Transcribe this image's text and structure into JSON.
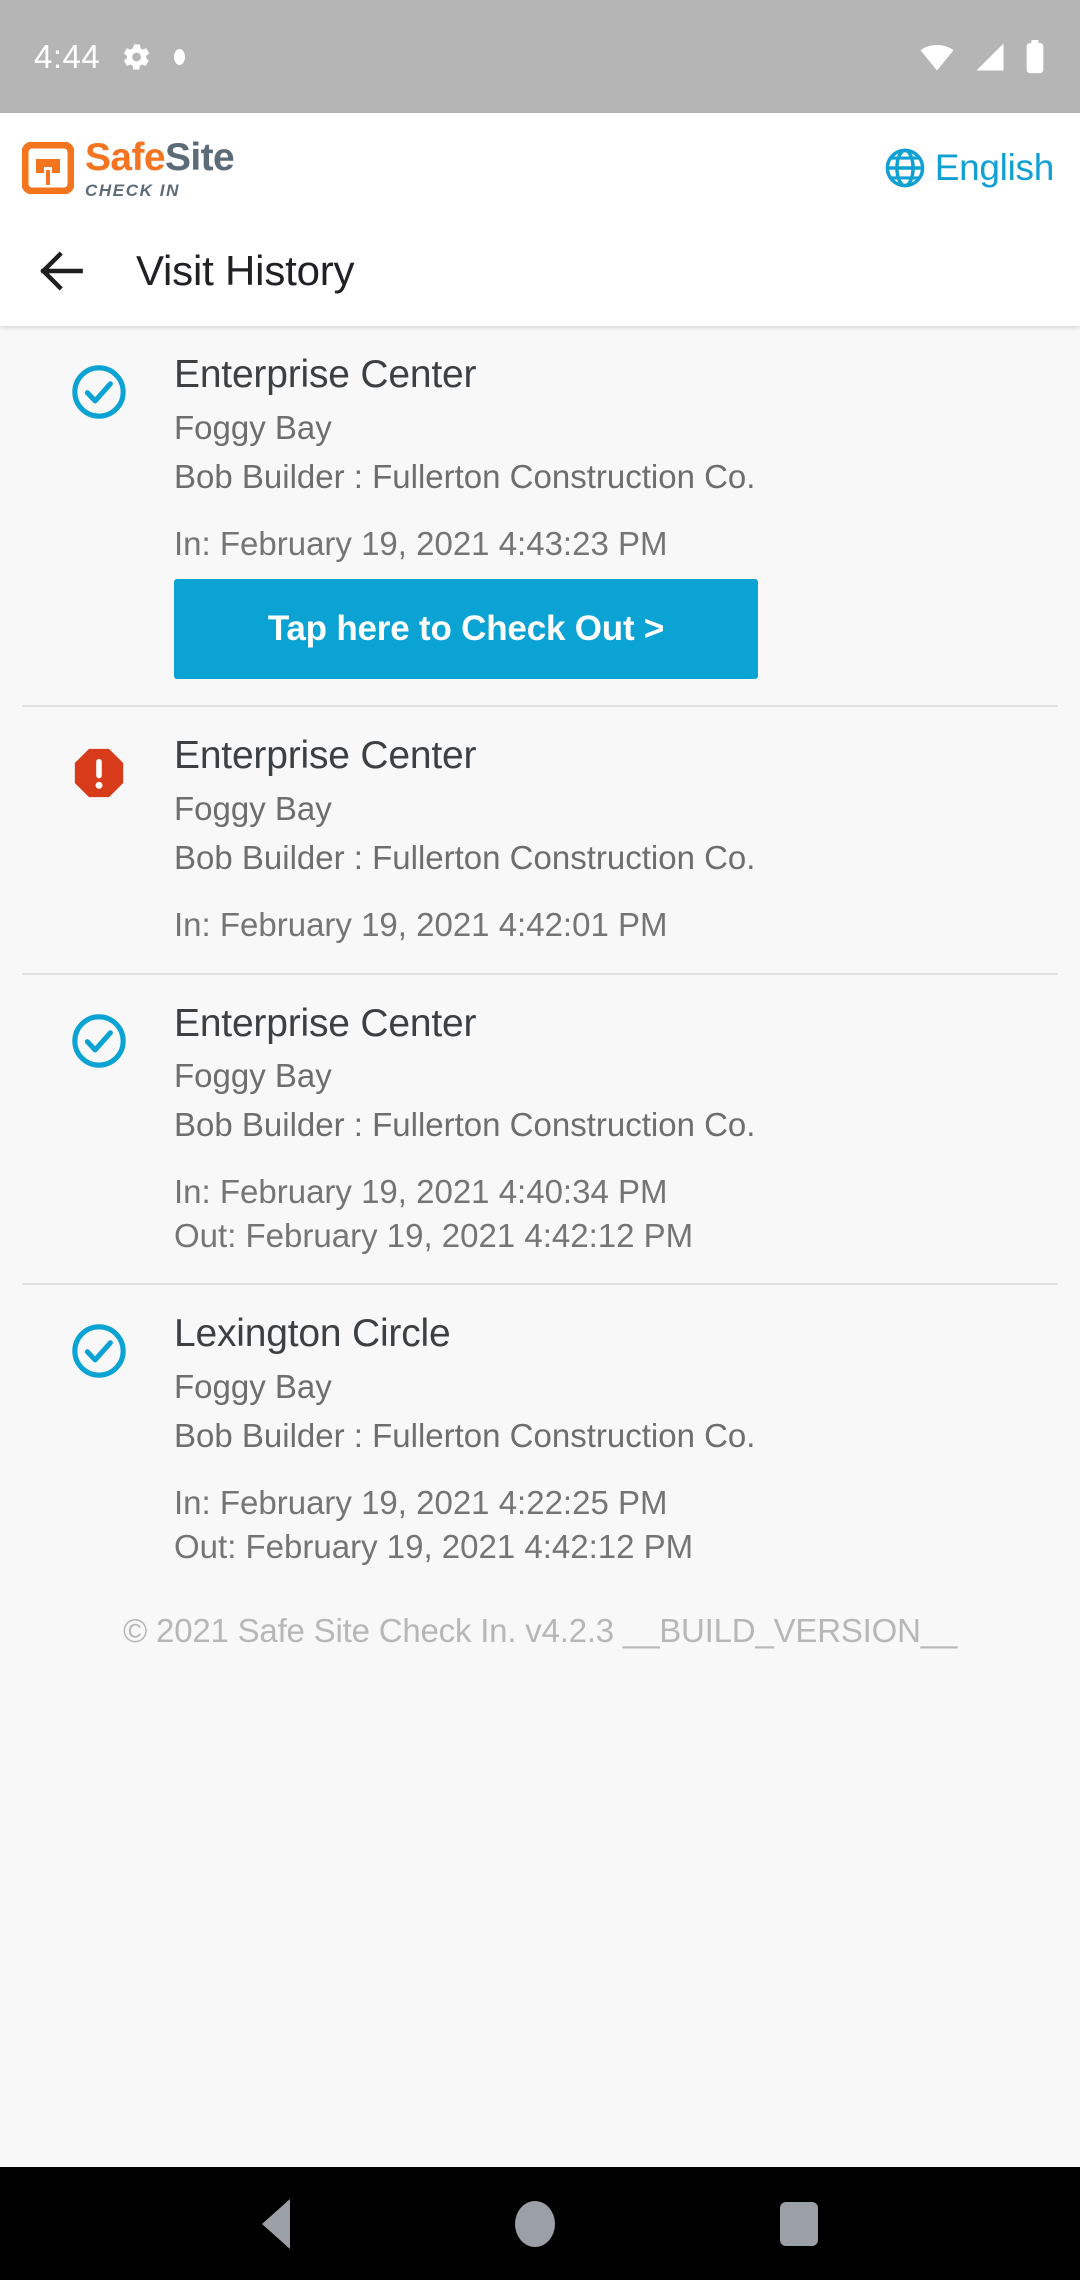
{
  "statusbar": {
    "time": "4:44",
    "icons": [
      "gear-icon",
      "dot-icon",
      "wifi-icon",
      "signal-icon",
      "battery-icon"
    ]
  },
  "header": {
    "logo": {
      "mark": "safesite-logo-icon",
      "word_primary": "Safe",
      "word_secondary": "Site",
      "subtitle": "CHECK IN"
    },
    "language": {
      "icon": "globe-icon",
      "label": "English"
    },
    "back_icon": "back-arrow-icon",
    "title": "Visit History"
  },
  "colors": {
    "brand_orange": "#F47421",
    "brand_slate": "#5C6B78",
    "accent_blue": "#10A0D2",
    "button_blue": "#0BA3D3",
    "alert_red": "#D83B1A",
    "page_bg": "#F8F8F8",
    "statusbar_bg": "#B5B5B5"
  },
  "visits": [
    {
      "status": "checked-in",
      "status_icon": "check-circle-icon",
      "site": "Enterprise Center",
      "area": "Foggy Bay",
      "person": "Bob Builder : Fullerton Construction Co.",
      "time_in": "In: February 19, 2021 4:43:23 PM",
      "time_out": "",
      "action_label": "Tap here to Check Out >"
    },
    {
      "status": "alert",
      "status_icon": "alert-octagon-icon",
      "site": "Enterprise Center",
      "area": "Foggy Bay",
      "person": "Bob Builder : Fullerton Construction Co.",
      "time_in": "In: February 19, 2021 4:42:01 PM",
      "time_out": "",
      "action_label": ""
    },
    {
      "status": "complete",
      "status_icon": "check-circle-icon",
      "site": "Enterprise Center",
      "area": "Foggy Bay",
      "person": "Bob Builder : Fullerton Construction Co.",
      "time_in": "In: February 19, 2021 4:40:34 PM",
      "time_out": "Out: February 19, 2021 4:42:12 PM",
      "action_label": ""
    },
    {
      "status": "complete",
      "status_icon": "check-circle-icon",
      "site": "Lexington Circle",
      "area": "Foggy Bay",
      "person": "Bob Builder : Fullerton Construction Co.",
      "time_in": "In: February 19, 2021 4:22:25 PM",
      "time_out": "Out: February 19, 2021 4:42:12 PM",
      "action_label": ""
    }
  ],
  "footer": {
    "text": "© 2021 Safe Site Check In. v4.2.3 __BUILD_VERSION__"
  },
  "navbar": {
    "back": "nav-back-icon",
    "home": "nav-home-icon",
    "recent": "nav-recent-icon"
  }
}
